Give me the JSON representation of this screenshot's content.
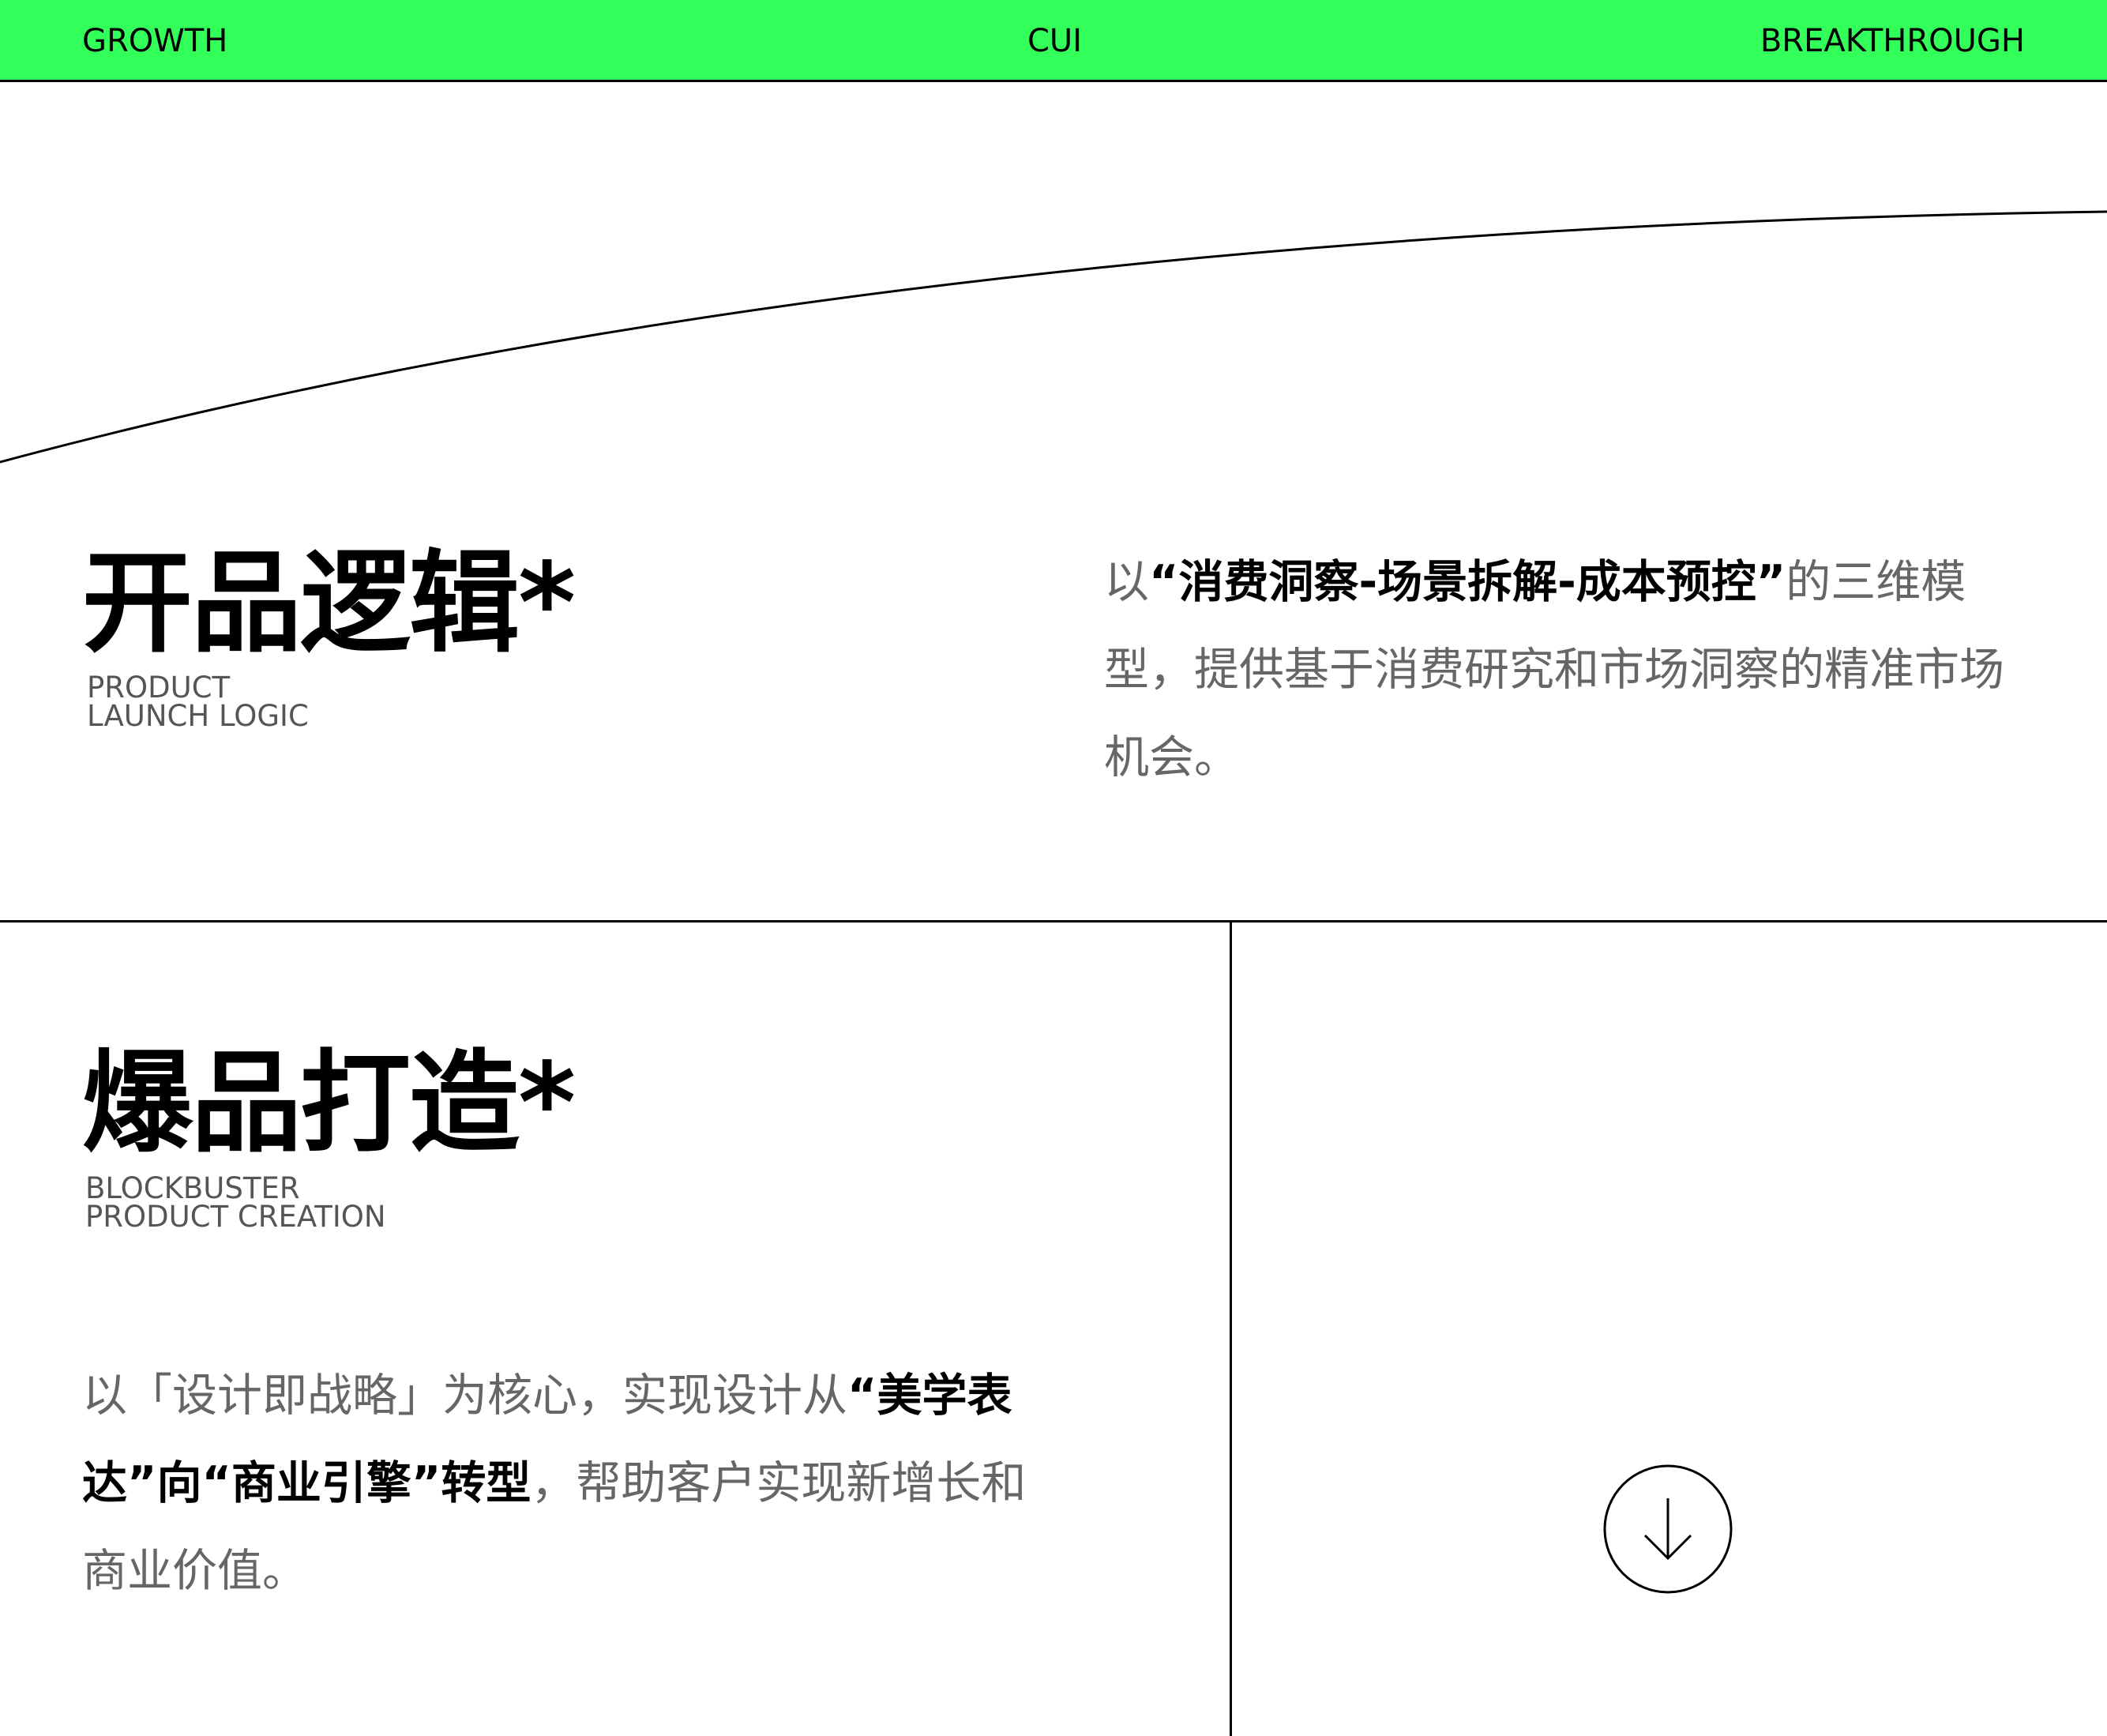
{
  "nav": {
    "left": "GROWTH",
    "center": "CUI",
    "right": "BREAKTHROUGH"
  },
  "section1": {
    "title": "开品逻辑*",
    "subtitle": "PRODUCT\nLAUNCH LOGIC",
    "para": {
      "pre": "以",
      "bold": "“消费洞察-场景拆解-成本预控”",
      "post": "的三维模型，提供基于消费研究和市场洞察的精准市场机会。"
    }
  },
  "section2": {
    "title": "爆品打造*",
    "subtitle": "BLOCKBUSTER\nPRODUCT CREATION",
    "para": {
      "pre": "以「设计即战略」为核心，实现设计从",
      "bold": "“美学表达”向“商业引擎”转型",
      "post": "，帮助客户实现新增长和商业价值。"
    }
  },
  "icons": {
    "scroll": "arrow-down-circle-icon"
  },
  "colors": {
    "accent": "#33ff5b",
    "text": "#000000",
    "muted": "#666666"
  }
}
